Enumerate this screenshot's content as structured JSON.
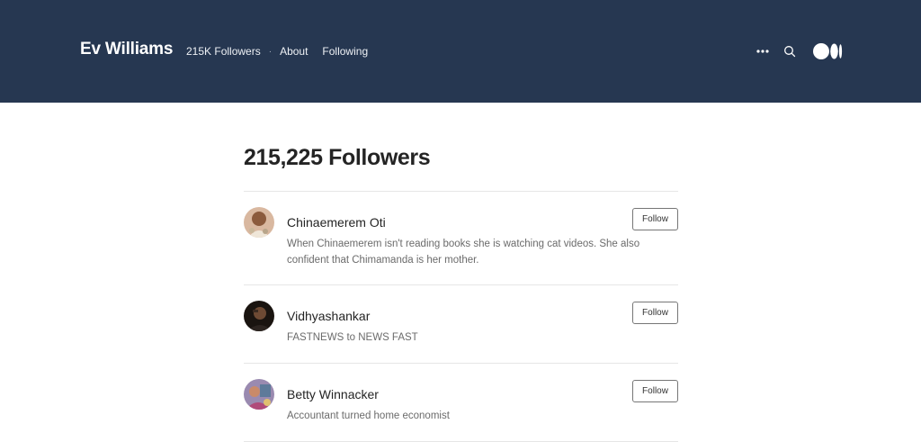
{
  "header": {
    "brand": "Ev Williams",
    "nav": {
      "followers": "215K Followers",
      "separator": "·",
      "about": "About",
      "following": "Following"
    },
    "icons": [
      "more-icon",
      "search-icon",
      "medium-logo-icon"
    ],
    "background": "#263751"
  },
  "main": {
    "title": "215,225 Followers",
    "followers": [
      {
        "name": "Chinaemerem Oti",
        "bio": "When Chinaemerem isn't reading books she is watching cat videos. She also confident that Chimamanda is her mother.",
        "button": "Follow"
      },
      {
        "name": "Vidhyashankar",
        "bio": "FASTNEWS to NEWS FAST",
        "button": "Follow"
      },
      {
        "name": "Betty Winnacker",
        "bio": "Accountant turned home economist",
        "button": "Follow"
      }
    ]
  }
}
